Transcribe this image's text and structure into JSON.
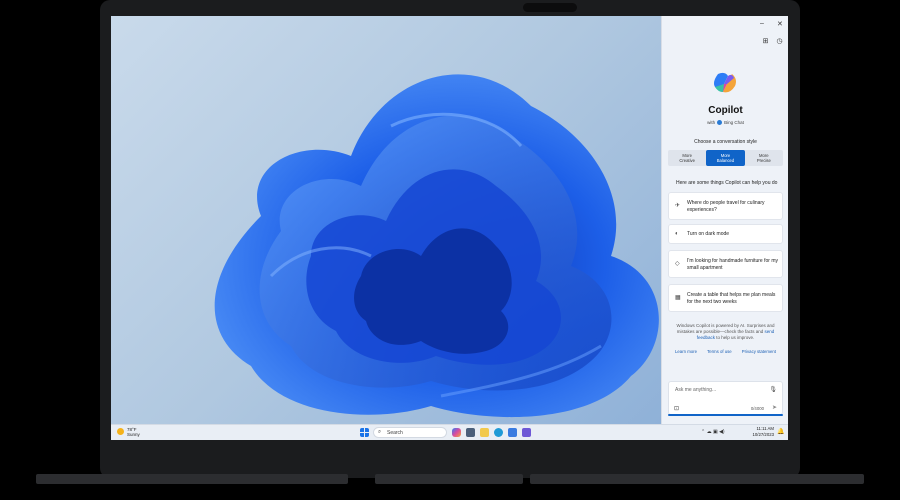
{
  "copilot": {
    "title": "Copilot",
    "subtitle_prefix": "with",
    "subtitle_brand": "Bing Chat",
    "choose_style": "Choose a conversation style",
    "styles": [
      {
        "line1": "More",
        "line2": "Creative"
      },
      {
        "line1": "More",
        "line2": "Balanced"
      },
      {
        "line1": "More",
        "line2": "Precise"
      }
    ],
    "active_style_index": 1,
    "help_heading": "Here are some things Copilot can help you do",
    "suggestions": [
      {
        "icon": "airplane-icon",
        "text": "Where do people travel for culinary experiences?"
      },
      {
        "icon": "dark-mode-icon",
        "text": "Turn on dark mode"
      },
      {
        "icon": "tag-icon",
        "text": "I'm looking for handmade furniture for my small apartment"
      },
      {
        "icon": "table-icon",
        "text": "Create a table that helps me plan meals for the next two weeks"
      }
    ],
    "disclaimer_before": "Windows Copilot is powered by AI. Surprises and mistakes are possible—check the facts and ",
    "disclaimer_link": "send feedback",
    "disclaimer_after": " to help us improve.",
    "links": [
      "Learn more",
      "Terms of use",
      "Privacy statement"
    ],
    "input_placeholder": "Ask me anything...",
    "char_count": "0/4000"
  },
  "taskbar": {
    "weather_temp": "78°F",
    "weather_desc": "Sunny",
    "search_placeholder": "Search",
    "time": "11:11 AM",
    "date": "10/27/2023"
  },
  "colors": {
    "accent": "#1064c8",
    "wallpaper_blue": "#1f5fe0"
  }
}
